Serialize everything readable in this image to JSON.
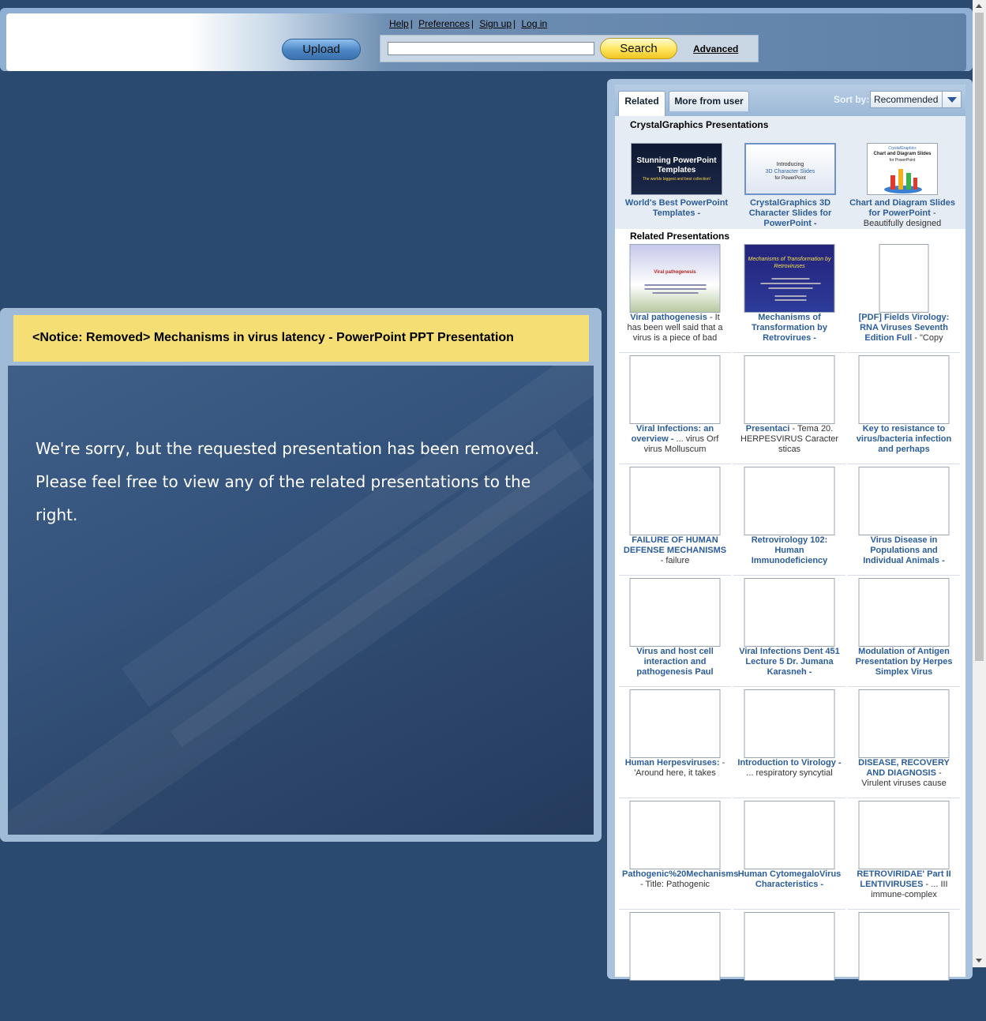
{
  "header": {
    "links": [
      {
        "label": "Help"
      },
      {
        "label": "Preferences"
      },
      {
        "label": "Sign up"
      },
      {
        "label": "Log in"
      }
    ],
    "upload_label": "Upload",
    "search_value": "",
    "search_label": "Search",
    "advanced_label": "Advanced"
  },
  "notice": {
    "title": "<Notice: Removed> Mechanisms in virus latency - PowerPoint PPT Presentation",
    "message": "We're sorry, but the requested presentation has been removed. Please feel free to view any of the related presentations to the right."
  },
  "sidebar": {
    "tabs": [
      {
        "label": "Related",
        "active": true
      },
      {
        "label": "More from user",
        "active": false
      }
    ],
    "sort_label": "Sort by:",
    "sort_value": "Recommended",
    "featured_heading": "CrystalGraphics Presentations",
    "featured": [
      {
        "title": "World's Best PowerPoint Templates -",
        "desc": "",
        "thumb_lines": [
          "Stunning PowerPoint",
          "Templates",
          "The worlds biggest and best collection!"
        ]
      },
      {
        "title": "CrystalGraphics 3D Character Slides for PowerPoint -",
        "desc": "",
        "thumb_lines": [
          "Introducing",
          "3D Character Slides",
          "for PowerPoint"
        ]
      },
      {
        "title": "Chart and Diagram Slides for PowerPoint",
        "desc": "- Beautifully designed",
        "thumb_lines": [
          "CrystalGraphics",
          "Chart and Diagram Slides",
          "for PowerPoint"
        ]
      }
    ],
    "related_heading": "Related Presentations",
    "related": [
      {
        "title": "Viral pathogenesis",
        "desc": "- It has been well said that a virus is a piece of bad",
        "thumb_text": "Viral pathogenesis"
      },
      {
        "title": "Mechanisms of Transformation by Retrovirues -",
        "desc": "",
        "thumb_text": "Mechanisms of Transformation by Retroviruses"
      },
      {
        "title": "[PDF] Fields Virology: RNA Viruses Seventh Edition Full",
        "desc": "- \"Copy",
        "thumb_text": ""
      },
      {
        "title": "Viral Infections: an overview -",
        "desc": "... virus Orf virus Molluscum",
        "thumb_text": ""
      },
      {
        "title": "Presentaci",
        "desc": "- Tema 20. HERPESVIRUS Caracter sticas",
        "thumb_text": ""
      },
      {
        "title": "Key to resistance to virus/bacteria infection and perhaps",
        "desc": "",
        "thumb_text": ""
      },
      {
        "title": "FAILURE OF HUMAN DEFENSE MECHANISMS",
        "desc": "- failure",
        "thumb_text": ""
      },
      {
        "title": "Retrovirology 102: Human Immunodeficiency",
        "desc": "",
        "thumb_text": ""
      },
      {
        "title": "Virus Disease in Populations and Individual Animals -",
        "desc": "",
        "thumb_text": ""
      },
      {
        "title": "Virus and host cell interaction and pathogenesis Paul",
        "desc": "",
        "thumb_text": ""
      },
      {
        "title": "Viral Infections Dent 451 Lecture 5 Dr. Jumana Karasneh -",
        "desc": "",
        "thumb_text": ""
      },
      {
        "title": "Modulation of Antigen Presentation by Herpes Simplex Virus",
        "desc": "",
        "thumb_text": ""
      },
      {
        "title": "Human Herpesviruses:",
        "desc": "- 'Around here, it takes",
        "thumb_text": ""
      },
      {
        "title": "Introduction to Virology -",
        "desc": "... respiratory syncytial",
        "thumb_text": ""
      },
      {
        "title": "DISEASE, RECOVERY AND DIAGNOSIS",
        "desc": "- Virulent viruses cause",
        "thumb_text": ""
      },
      {
        "title": "Pathogenic%20Mechanisms",
        "desc": "- Title: Pathogenic",
        "thumb_text": ""
      },
      {
        "title": "Human CytomegaloVirus Characteristics -",
        "desc": "",
        "thumb_text": ""
      },
      {
        "title": "RETROVIRIDAE' Part II LENTIVIRUSES",
        "desc": "- ... III immune-complex",
        "thumb_text": ""
      },
      {
        "title": "",
        "desc": "",
        "thumb_text": ""
      },
      {
        "title": "",
        "desc": "",
        "thumb_text": ""
      },
      {
        "title": "",
        "desc": "",
        "thumb_text": ""
      }
    ]
  }
}
